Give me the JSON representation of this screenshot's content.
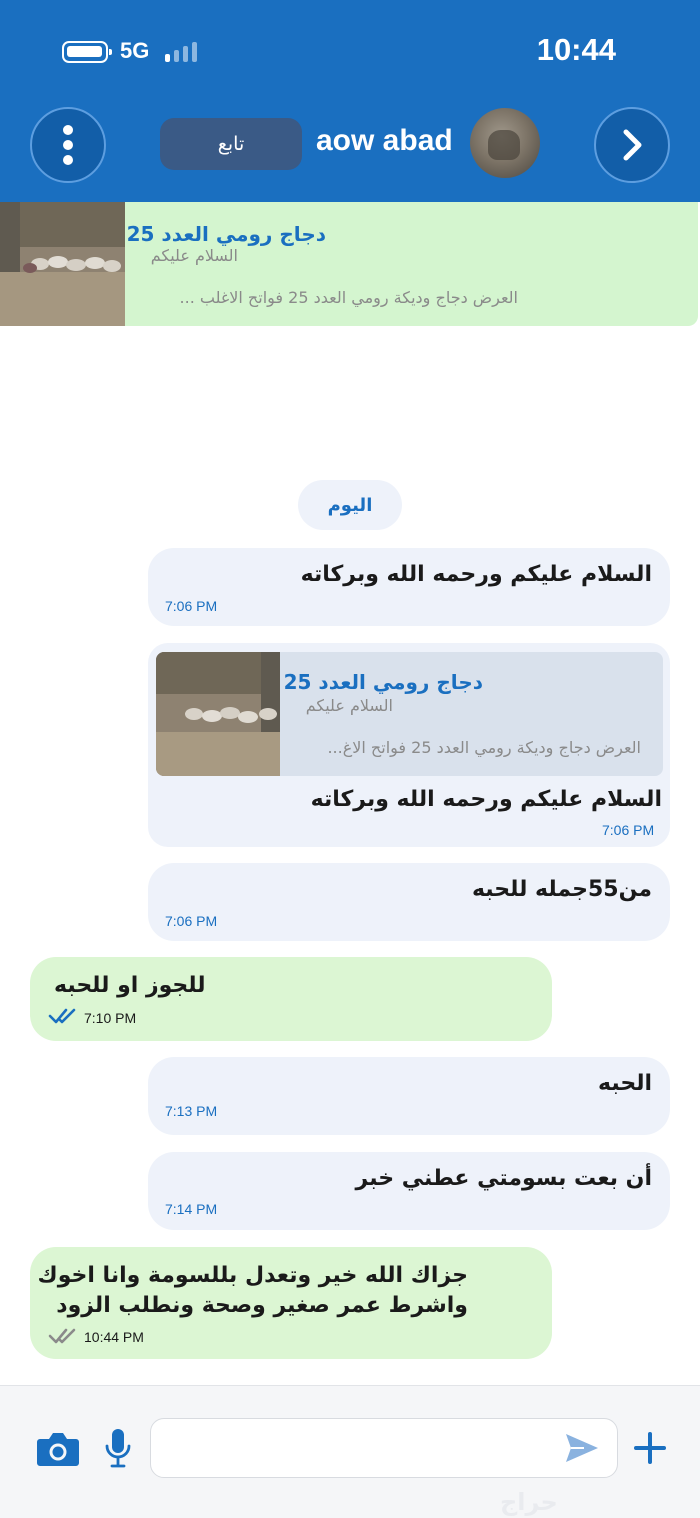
{
  "status_bar": {
    "network": "5G",
    "time": "10:44"
  },
  "header": {
    "follow_label": "تابع",
    "user_name": "aow abad"
  },
  "listing": {
    "title": "دجاج رومي العدد 25",
    "greeting": "السلام عليكم",
    "description": "العرض دجاج وديكة رومي العدد 25 فواتح الاغلب ..."
  },
  "date_label": "اليوم",
  "messages": [
    {
      "text": "السلام عليكم ورحمه الله وبركاته",
      "time": "7:06 PM"
    },
    {
      "quote": {
        "title": "دجاج رومي العدد 25",
        "greeting": "السلام عليكم",
        "description": "العرض دجاج وديكة رومي العدد 25 فواتح الاغ..."
      },
      "text": "السلام عليكم ورحمه الله وبركاته",
      "time": "7:06 PM"
    },
    {
      "text": "من55جمله للحبه",
      "time": "7:06 PM"
    },
    {
      "text": "للجوز او للحبه",
      "time": "7:10 PM"
    },
    {
      "text": "الحبه",
      "time": "7:13 PM"
    },
    {
      "text": "أن بعت بسومتي عطني خبر",
      "time": "7:14 PM"
    },
    {
      "line1": "جزاك الله خير وتعدل بللسومة   وانا اخوك",
      "line2": "واشرط عمر صغير وصحة ونطلب الزود",
      "time": "10:44 PM"
    }
  ],
  "composer": {
    "placeholder": ""
  },
  "watermark": "حراج",
  "colors": {
    "header": "#1a6fc0",
    "incoming_bubble": "#eef2fa",
    "outgoing_bubble": "#dcf6d3",
    "listing_bg": "#d4f5cf",
    "read_tick": "#1a6fc0",
    "sent_tick": "#8a8a8a"
  }
}
